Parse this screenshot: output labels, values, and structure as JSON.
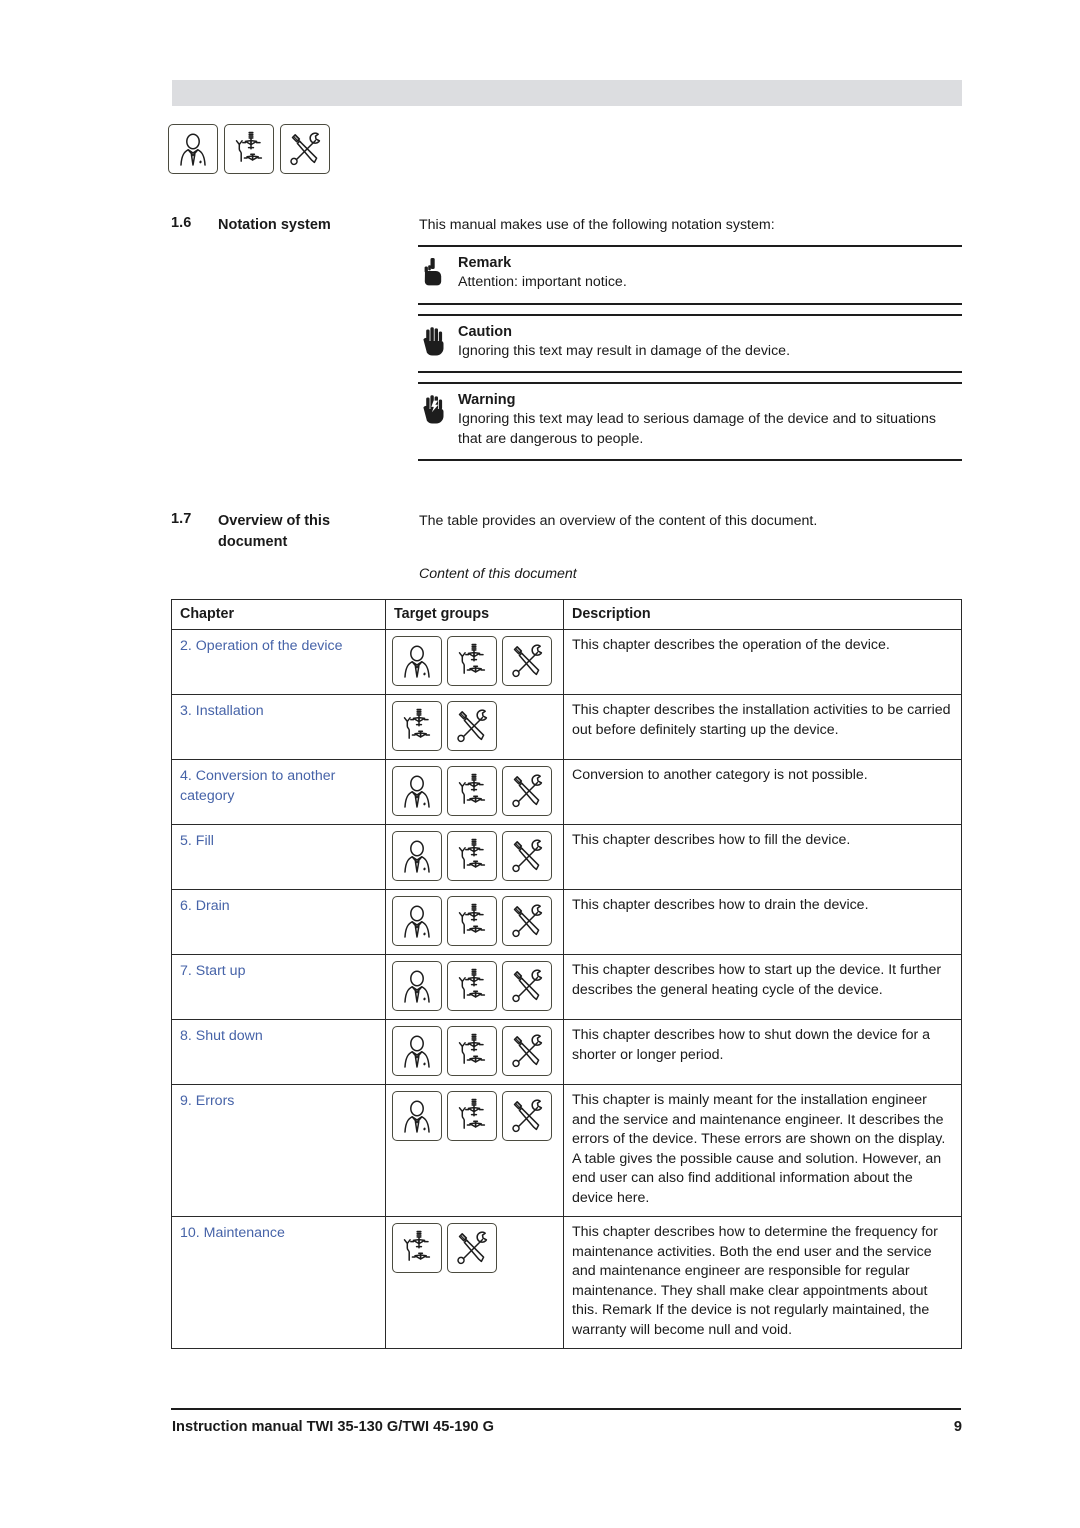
{
  "document": {
    "footer_text": "Instruction manual TWI 35-130 G/TWI 45-190 G",
    "page_number": "9",
    "link_color": "#4663a8",
    "band_color": "#dcdde0"
  },
  "header": {
    "icons": [
      "end-user-icon",
      "installation-engineer-icon",
      "service-maintenance-engineer-icon"
    ]
  },
  "section_notation": {
    "number": "1.6",
    "title": "Notation system",
    "intro": "This manual makes use of the following notation system:",
    "notes": [
      {
        "icon": "pointing-finger-icon",
        "title": "Remark",
        "body": "Attention: important notice."
      },
      {
        "icon": "open-palm-icon",
        "title": "Caution",
        "body": "Ignoring this text may result in damage of the device."
      },
      {
        "icon": "hand-lightning-icon",
        "title": "Warning",
        "body": "Ignoring this text may lead to serious damage of the device and to situations that are dangerous to people."
      }
    ]
  },
  "section_overview": {
    "number": "1.7",
    "title": "Overview of this document",
    "intro": "The table provides an overview of the content of this document.",
    "caption": "Content of this document",
    "table": {
      "headers": [
        "Chapter",
        "Target groups",
        "Description"
      ],
      "rows": [
        {
          "chapter": "2. Operation of the device",
          "targets": [
            "end-user-icon",
            "installation-engineer-icon",
            "service-maintenance-engineer-icon"
          ],
          "description": "This chapter describes the operation of the device."
        },
        {
          "chapter": "3. Installation",
          "targets": [
            "installation-engineer-icon",
            "service-maintenance-engineer-icon"
          ],
          "description": "This chapter describes the installation activities to be carried out before definitely starting up the device."
        },
        {
          "chapter": "4. Conversion to another category",
          "targets": [
            "end-user-icon",
            "installation-engineer-icon",
            "service-maintenance-engineer-icon"
          ],
          "description": "Conversion to another category is not possible."
        },
        {
          "chapter": "5. Fill",
          "targets": [
            "end-user-icon",
            "installation-engineer-icon",
            "service-maintenance-engineer-icon"
          ],
          "description": "This chapter describes how to fill the device."
        },
        {
          "chapter": "6. Drain",
          "targets": [
            "end-user-icon",
            "installation-engineer-icon",
            "service-maintenance-engineer-icon"
          ],
          "description": "This chapter describes how to drain the device."
        },
        {
          "chapter": "7. Start up",
          "targets": [
            "end-user-icon",
            "installation-engineer-icon",
            "service-maintenance-engineer-icon"
          ],
          "description": "This chapter describes how to start up the device. It further describes the general heating cycle of the device."
        },
        {
          "chapter": "8. Shut down",
          "targets": [
            "end-user-icon",
            "installation-engineer-icon",
            "service-maintenance-engineer-icon"
          ],
          "description": "This chapter describes how to shut down the device for a shorter or longer period."
        },
        {
          "chapter": "9. Errors",
          "targets": [
            "end-user-icon",
            "installation-engineer-icon",
            "service-maintenance-engineer-icon"
          ],
          "description": "This chapter is mainly meant for the installation engineer and the service and maintenance engineer. It describes the errors of the device. These errors are shown on the display. A table gives the possible cause and solution. However, an end user can also find additional information about the device here."
        },
        {
          "chapter": "10. Maintenance",
          "targets": [
            "installation-engineer-icon",
            "service-maintenance-engineer-icon"
          ],
          "description": "This chapter describes how to determine the frequency for maintenance activities. Both the end user and the service and maintenance engineer are responsible for regular maintenance. They shall make clear appointments about this. Remark If the device is not regularly maintained, the warranty will become null and void."
        }
      ]
    }
  }
}
